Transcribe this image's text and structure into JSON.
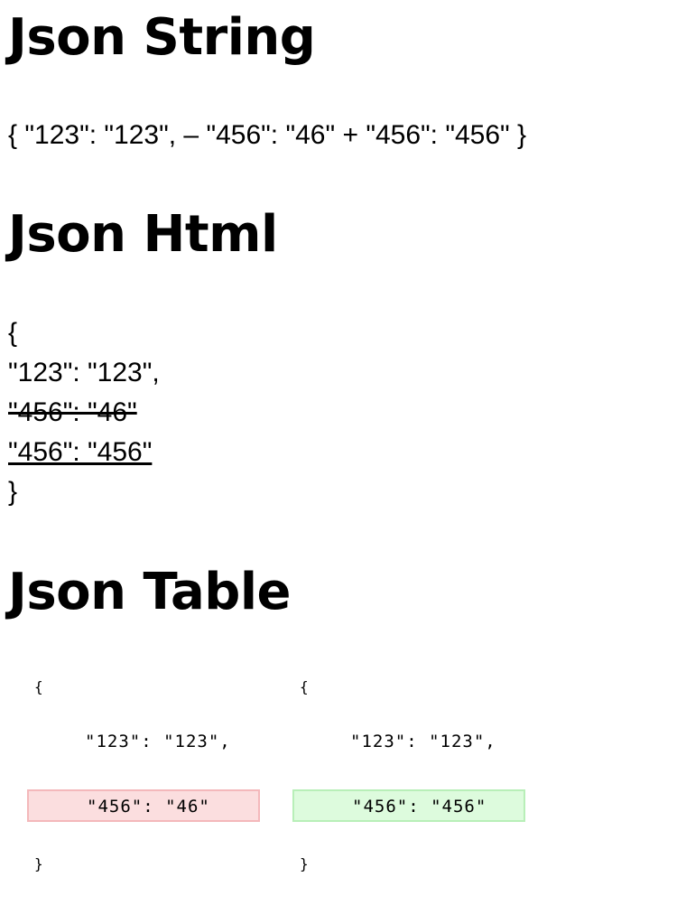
{
  "sections": {
    "string_title": "Json String",
    "html_title": "Json Html",
    "table_title": "Json Table"
  },
  "json_string": {
    "open": "{ ",
    "unchanged": "\"123\": \"123\", ",
    "removed_marker": "– ",
    "removed": "\"456\": \"46\" ",
    "added_marker": "+ ",
    "added": "\"456\": \"456\" ",
    "close": "}"
  },
  "json_html": {
    "open": "{",
    "unchanged": "\"123\": \"123\",",
    "removed": "\"456\": \"46\"",
    "added": "\"456\": \"456\"",
    "close": "}"
  },
  "json_table": {
    "left": {
      "open": "{",
      "unchanged": "\"123\": \"123\",",
      "removed": "\"456\": \"46\"",
      "close": "}"
    },
    "right": {
      "open": "{",
      "unchanged": "\"123\": \"123\",",
      "added": "\"456\": \"456\"",
      "close": "}"
    },
    "colors": {
      "removed_bg": "#fbdedf",
      "removed_border": "#f4b8bb",
      "added_bg": "#ddfbdd",
      "added_border": "#b8efb8"
    }
  }
}
